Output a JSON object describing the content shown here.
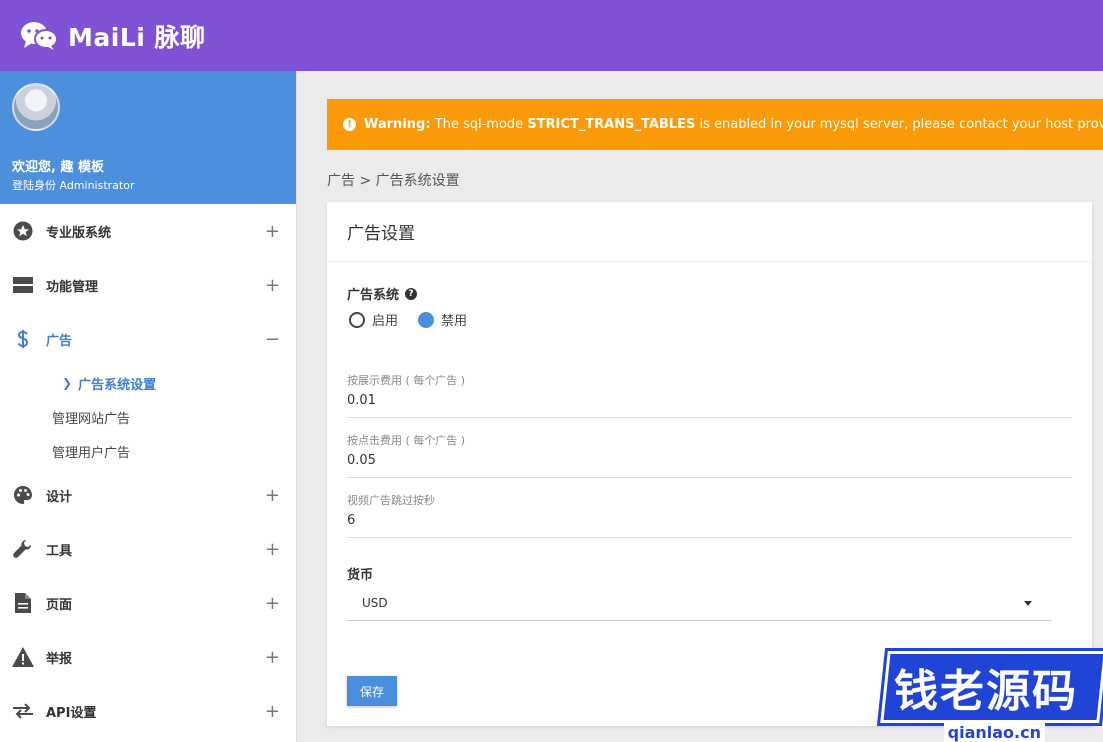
{
  "header": {
    "app_name": "MaiLi 脉聊",
    "brand_color": "#8052d6"
  },
  "profile": {
    "welcome": "欢迎您, 趣 模板",
    "role": "登陆身份 Administrator"
  },
  "sidebar": {
    "items": [
      {
        "label": "专业版系统",
        "icon": "star-circle-icon",
        "toggle": "+"
      },
      {
        "label": "功能管理",
        "icon": "tiles-icon",
        "toggle": "+"
      },
      {
        "label": "广告",
        "icon": "dollar-icon",
        "toggle": "−",
        "active": true,
        "subitems": [
          {
            "label": "广告系统设置",
            "current": true
          },
          {
            "label": "管理网站广告"
          },
          {
            "label": "管理用户广告"
          }
        ]
      },
      {
        "label": "设计",
        "icon": "palette-icon",
        "toggle": "+"
      },
      {
        "label": "工具",
        "icon": "wrench-icon",
        "toggle": "+"
      },
      {
        "label": "页面",
        "icon": "document-icon",
        "toggle": "+"
      },
      {
        "label": "举报",
        "icon": "warning-triangle-icon",
        "toggle": "+"
      },
      {
        "label": "API设置",
        "icon": "arrows-icon",
        "toggle": "+"
      }
    ]
  },
  "warning": {
    "prefix": "Warning:",
    "text_a": " The sql-mode ",
    "code": "STRICT_TRANS_TABLES",
    "text_b": " is enabled in your mysql server, please contact your host provider to di",
    "color": "#fa9a09"
  },
  "breadcrumb": "广告 > 广告系统设置",
  "card": {
    "title": "广告设置",
    "ad_system": {
      "label": "广告系统",
      "options": [
        {
          "label": "启用",
          "checked": false
        },
        {
          "label": "禁用",
          "checked": true
        }
      ]
    },
    "fields": [
      {
        "label": "按展示费用 ( 每个广告 )",
        "value": "0.01"
      },
      {
        "label": "按点击费用 ( 每个广告 )",
        "value": "0.05"
      },
      {
        "label": "视频广告跳过按秒",
        "value": "6"
      }
    ],
    "currency": {
      "label": "货币",
      "value": "USD"
    },
    "save_label": "保存"
  },
  "watermark": {
    "text": "钱老源码",
    "site": "qianlao.cn"
  }
}
